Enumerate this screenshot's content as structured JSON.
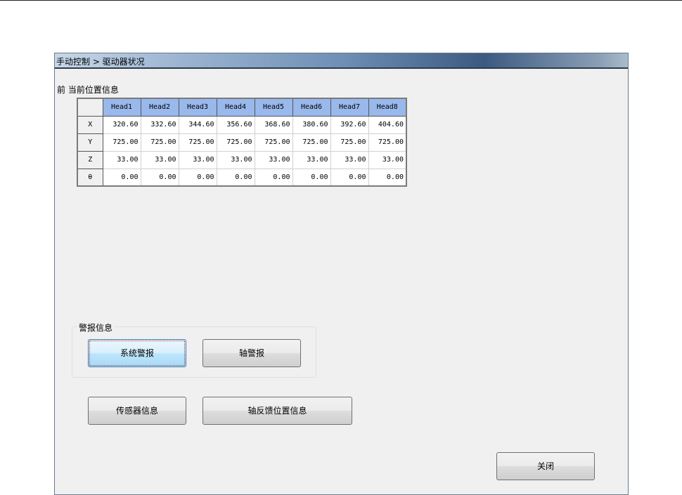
{
  "title": "手动控制 > 驱动器状况",
  "position_label": "前 当前位置信息",
  "table": {
    "headers": [
      "Head1",
      "Head2",
      "Head3",
      "Head4",
      "Head5",
      "Head6",
      "Head7",
      "Head8"
    ],
    "rows": [
      {
        "label": "X",
        "values": [
          "320.60",
          "332.60",
          "344.60",
          "356.60",
          "368.60",
          "380.60",
          "392.60",
          "404.60"
        ]
      },
      {
        "label": "Y",
        "values": [
          "725.00",
          "725.00",
          "725.00",
          "725.00",
          "725.00",
          "725.00",
          "725.00",
          "725.00"
        ]
      },
      {
        "label": "Z",
        "values": [
          "33.00",
          "33.00",
          "33.00",
          "33.00",
          "33.00",
          "33.00",
          "33.00",
          "33.00"
        ]
      },
      {
        "label": "θ",
        "values": [
          "0.00",
          "0.00",
          "0.00",
          "0.00",
          "0.00",
          "0.00",
          "0.00",
          "0.00"
        ]
      }
    ]
  },
  "alarm_group": "警报信息",
  "buttons": {
    "system_alarm": "系统警报",
    "axis_alarm": "轴警报",
    "sensor_info": "传感器信息",
    "axis_feedback": "轴反馈位置信息",
    "close": "关闭"
  }
}
